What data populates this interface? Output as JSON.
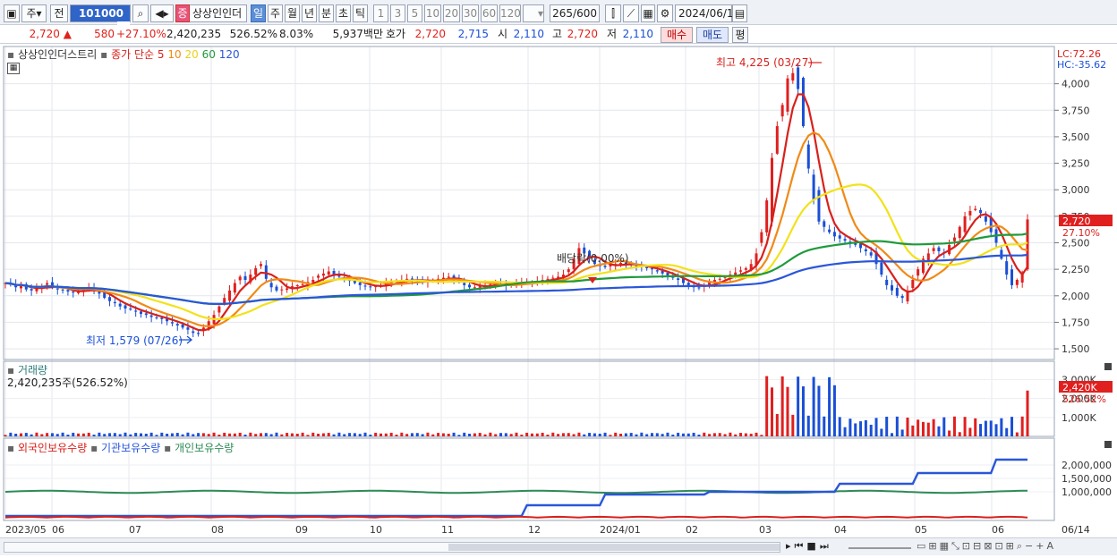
{
  "toolbar": {
    "type_label": "주",
    "market_label": "전",
    "code": "101000",
    "stock_badge": "증",
    "stock_name": "상상인인더",
    "periods": [
      "일",
      "주",
      "월",
      "년",
      "분",
      "초",
      "틱"
    ],
    "selected_period": "일",
    "intervals": [
      "1",
      "3",
      "5",
      "10",
      "20",
      "30",
      "60",
      "120"
    ],
    "count": "265",
    "count_max": "/600",
    "date": "2024/06/14"
  },
  "quote": {
    "price": "2,720",
    "price_arrow": "▲",
    "change": "580",
    "change_pct": "+27.10%",
    "volume": "2,420,235",
    "volume_ratio": "526.52%",
    "turnover_pct": "8.03%",
    "amount": "5,937백만",
    "quote_label": "호가",
    "ask": "2,720",
    "bid": "2,715",
    "open_label": "시",
    "open": "2,110",
    "high_label": "고",
    "high": "2,720",
    "low_label": "저",
    "low": "2,110",
    "buy_label": "매수",
    "sell_label": "매도",
    "eval_label": "평"
  },
  "price_panel": {
    "title": "상상인인더스트리",
    "ma_label": "종가 단순",
    "ma_periods": [
      "5",
      "10",
      "20",
      "60",
      "120"
    ],
    "ma_colors": [
      "#d8211c",
      "#f08a16",
      "#f2e21a",
      "#1f9a3c",
      "#2a56d8"
    ],
    "lc": "LC:72.26",
    "hc": "HC:-35.62",
    "y_ticks": [
      "4,000",
      "3,750",
      "3,500",
      "3,250",
      "3,000",
      "2,750",
      "2,500",
      "2,250",
      "2,000",
      "1,750",
      "1,500"
    ],
    "current_tag": "2,720",
    "current_pct_tag": "27.10%",
    "max_annotation": "최고 4,225 (03/27)",
    "min_annotation": "최저 1,579 (07/26)",
    "dividend_annotation": "배당락(0.00%)"
  },
  "volume_panel": {
    "title": "거래량",
    "value": "2,420,235주(526.52%)",
    "y_ticks": [
      "3,000K",
      "2,000K",
      "1,000K"
    ],
    "current_tag": "2,420K",
    "current_pct_tag": "526.52%"
  },
  "holdings_panel": {
    "series": [
      "외국인보유수량",
      "기관보유수량",
      "개인보유수량"
    ],
    "series_colors": [
      "#d8211c",
      "#2a56d8",
      "#2e8b57"
    ],
    "y_ticks": [
      "2,000,000",
      "1,500,000",
      "1,000,000"
    ]
  },
  "x_axis": {
    "labels": [
      "2023/05",
      "06",
      "07",
      "08",
      "09",
      "10",
      "11",
      "12",
      "2024/01",
      "02",
      "03",
      "04",
      "05",
      "06"
    ],
    "end_label": "06/14"
  },
  "chart_data": {
    "type": "line",
    "price_range": [
      1500,
      4200
    ],
    "close_series": [
      2120,
      2110,
      2080,
      2100,
      2060,
      2050,
      2070,
      2090,
      2120,
      2080,
      2060,
      2050,
      2040,
      2030,
      2040,
      2060,
      2080,
      2050,
      2020,
      1980,
      1950,
      1930,
      1900,
      1880,
      1870,
      1850,
      1830,
      1820,
      1800,
      1790,
      1780,
      1760,
      1740,
      1720,
      1700,
      1680,
      1650,
      1640,
      1700,
      1760,
      1820,
      1900,
      1980,
      2050,
      2120,
      2180,
      2150,
      2200,
      2260,
      2300,
      2160,
      2080,
      2050,
      2060,
      2070,
      2090,
      2100,
      2110,
      2130,
      2150,
      2190,
      2210,
      2230,
      2200,
      2180,
      2160,
      2140,
      2120,
      2100,
      2090,
      2080,
      2090,
      2100,
      2120,
      2130,
      2140,
      2150,
      2160,
      2150,
      2140,
      2130,
      2140,
      2150,
      2160,
      2170,
      2180,
      2160,
      2140,
      2100,
      2080,
      2080,
      2090,
      2100,
      2110,
      2120,
      2110,
      2100,
      2110,
      2120,
      2120,
      2130,
      2130,
      2140,
      2150,
      2160,
      2170,
      2180,
      2200,
      2250,
      2350,
      2450,
      2400,
      2350,
      2300,
      2280,
      2270,
      2290,
      2300,
      2310,
      2300,
      2290,
      2280,
      2270,
      2260,
      2250,
      2230,
      2210,
      2190,
      2170,
      2150,
      2120,
      2100,
      2080,
      2070,
      2100,
      2130,
      2150,
      2160,
      2180,
      2200,
      2220,
      2240,
      2260,
      2300,
      2400,
      2600,
      2900,
      3300,
      3600,
      3800,
      4050,
      4100,
      3950,
      3600,
      3200,
      2900,
      2700,
      2650,
      2600,
      2560,
      2540,
      2520,
      2500,
      2480,
      2450,
      2420,
      2380,
      2300,
      2200,
      2100,
      2050,
      2000,
      1980,
      2050,
      2150,
      2250,
      2350,
      2400,
      2450,
      2420,
      2400,
      2480,
      2550,
      2650,
      2750,
      2800,
      2820,
      2780,
      2700,
      2600,
      2500,
      2350,
      2200,
      2100,
      2150,
      2200,
      2720
    ],
    "ma_series": [
      "MA5",
      "MA10",
      "MA20",
      "MA60",
      "MA120"
    ]
  }
}
